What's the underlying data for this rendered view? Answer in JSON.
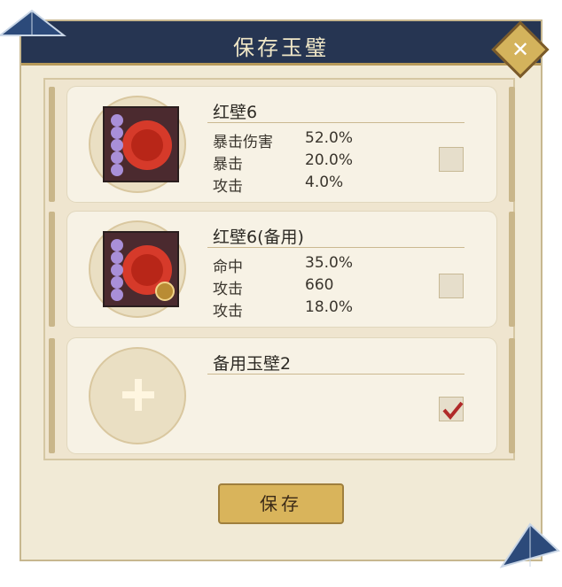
{
  "title": "保存玉璧",
  "items": [
    {
      "name": "红壁6",
      "stats": [
        {
          "label": "暴击伤害",
          "value": "52.0%"
        },
        {
          "label": "暴击",
          "value": "20.0%"
        },
        {
          "label": "攻击",
          "value": "4.0%"
        }
      ],
      "checked": false
    },
    {
      "name": "红壁6(备用)",
      "stats": [
        {
          "label": "命中",
          "value": "35.0%"
        },
        {
          "label": "攻击",
          "value": "660"
        },
        {
          "label": "攻击",
          "value": "18.0%"
        }
      ],
      "checked": false
    },
    {
      "name": "备用玉壁2",
      "stats": [],
      "checked": true
    }
  ],
  "save_label": "保存",
  "colors": {
    "header": "#263552",
    "accent": "#d9b45b",
    "checkmark": "#b02a2a"
  }
}
